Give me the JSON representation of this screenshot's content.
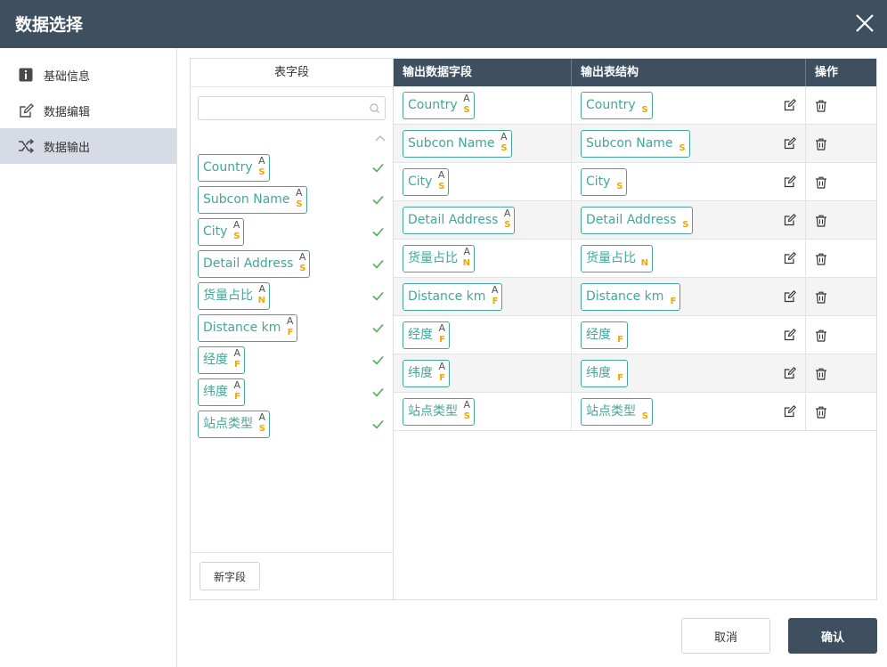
{
  "dialog": {
    "title": "数据选择"
  },
  "sidebar": {
    "items": [
      {
        "label": "基础信息",
        "icon": "info-icon",
        "active": false
      },
      {
        "label": "数据编辑",
        "icon": "edit-icon",
        "active": false
      },
      {
        "label": "数据输出",
        "icon": "shuffle-icon",
        "active": true
      }
    ]
  },
  "left_panel": {
    "header": "表字段",
    "search_placeholder": "",
    "new_field_label": "新字段",
    "fields": [
      {
        "name": "Country",
        "a": "A",
        "type": "S"
      },
      {
        "name": "Subcon Name",
        "a": "A",
        "type": "S"
      },
      {
        "name": "City",
        "a": "A",
        "type": "S"
      },
      {
        "name": "Detail Address",
        "a": "A",
        "type": "S"
      },
      {
        "name": "货量占比",
        "a": "A",
        "type": "N"
      },
      {
        "name": "Distance km",
        "a": "A",
        "type": "F"
      },
      {
        "name": "经度",
        "a": "A",
        "type": "F"
      },
      {
        "name": "纬度",
        "a": "A",
        "type": "F"
      },
      {
        "name": "站点类型",
        "a": "A",
        "type": "S"
      }
    ]
  },
  "table": {
    "headers": [
      "输出数据字段",
      "输出表结构",
      "操作"
    ],
    "rows": [
      {
        "field": "Country",
        "a": "A",
        "type": "S",
        "out": "Country",
        "out_type": "S"
      },
      {
        "field": "Subcon Name",
        "a": "A",
        "type": "S",
        "out": "Subcon Name",
        "out_type": "S"
      },
      {
        "field": "City",
        "a": "A",
        "type": "S",
        "out": "City",
        "out_type": "S"
      },
      {
        "field": "Detail Address",
        "a": "A",
        "type": "S",
        "out": "Detail Address",
        "out_type": "S"
      },
      {
        "field": "货量占比",
        "a": "A",
        "type": "N",
        "out": "货量占比",
        "out_type": "N"
      },
      {
        "field": "Distance km",
        "a": "A",
        "type": "F",
        "out": "Distance km",
        "out_type": "F"
      },
      {
        "field": "经度",
        "a": "A",
        "type": "F",
        "out": "经度",
        "out_type": "F"
      },
      {
        "field": "纬度",
        "a": "A",
        "type": "F",
        "out": "纬度",
        "out_type": "F"
      },
      {
        "field": "站点类型",
        "a": "A",
        "type": "S",
        "out": "站点类型",
        "out_type": "S"
      }
    ]
  },
  "footer": {
    "cancel_label": "取消",
    "confirm_label": "确认"
  },
  "colors": {
    "header_bg": "#3e4f5f",
    "tag_green": "#45a59a",
    "type_orange": "#f0a800",
    "check_green": "#4caf50",
    "active_bg": "#d6dbe5"
  }
}
